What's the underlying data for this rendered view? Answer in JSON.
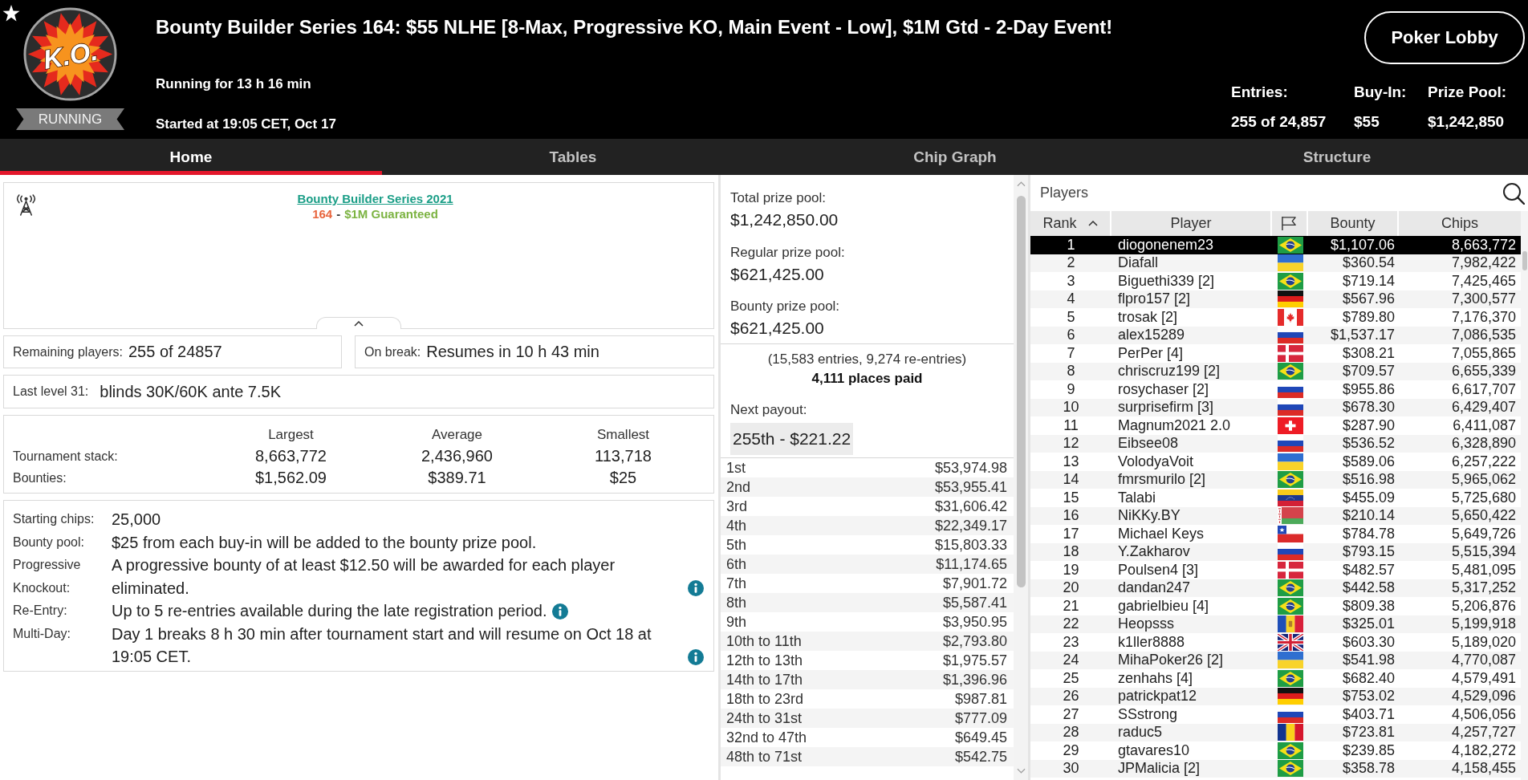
{
  "header": {
    "logo_text": "K.O.",
    "status": "RUNNING",
    "title": "Bounty Builder Series 164: $55 NLHE [8-Max, Progressive KO, Main Event - Low], $1M Gtd - 2-Day Event!",
    "running_for": "Running for 13 h 16 min",
    "started_at": "Started at 19:05 CET, Oct 17",
    "lobby_button": "Poker Lobby",
    "stats": [
      {
        "label": "Entries:",
        "value": "255 of 24,857"
      },
      {
        "label": "Buy-In:",
        "value": "$55"
      },
      {
        "label": "Prize Pool:",
        "value": "$1,242,850"
      }
    ]
  },
  "tabs": [
    {
      "label": "Home",
      "selected": true
    },
    {
      "label": "Tables",
      "selected": false
    },
    {
      "label": "Chip Graph",
      "selected": false
    },
    {
      "label": "Structure",
      "selected": false
    }
  ],
  "home": {
    "banner": {
      "link": "Bounty Builder Series 2021",
      "subtitle": [
        {
          "text": "164",
          "color": "#e8643c"
        },
        {
          "text": "-",
          "color": "#333333"
        },
        {
          "text": "$1M Guaranteed",
          "color": "#7cb342"
        }
      ]
    },
    "status_boxes": [
      {
        "label": "Remaining players:",
        "value": "255 of 24857"
      },
      {
        "label": "On break:",
        "value": "Resumes in 10 h 43 min"
      }
    ],
    "last_level": {
      "label": "Last level 31:",
      "value": "blinds 30K/60K ante 7.5K"
    },
    "stack_table": {
      "columns": [
        "Largest",
        "Average",
        "Smallest"
      ],
      "rows": [
        {
          "label": "Tournament stack:",
          "values": [
            "8,663,772",
            "2,436,960",
            "113,718"
          ]
        },
        {
          "label": "Bounties:",
          "values": [
            "$1,562.09",
            "$389.71",
            "$25"
          ]
        }
      ]
    },
    "details": [
      {
        "label": "Starting chips:",
        "value": "25,000",
        "info": false
      },
      {
        "label": "Bounty pool:",
        "value": "$25 from each buy-in will be added to the bounty prize pool.",
        "info": false
      },
      {
        "label": "Progressive Knockout:",
        "value": "A progressive bounty of at least $12.50 will be awarded for each player eliminated.",
        "info": true
      },
      {
        "label": "Re-Entry:",
        "value": "Up to 5 re-entries available during the late registration period.",
        "info": true
      },
      {
        "label": "Multi-Day:",
        "value": "Day 1 breaks 8 h 30 min after tournament start and will resume on Oct 18 at 19:05 CET.",
        "info": true
      }
    ]
  },
  "prizes": {
    "pools": [
      {
        "label": "Total prize pool:",
        "value": "$1,242,850.00"
      },
      {
        "label": "Regular prize pool:",
        "value": "$621,425.00"
      },
      {
        "label": "Bounty prize pool:",
        "value": "$621,425.00"
      }
    ],
    "entries_note": "(15,583 entries, 9,274 re-entries)",
    "places_paid": "4,111 places paid",
    "next_payout": {
      "label": "Next payout:",
      "value": "255th - $221.22"
    },
    "payouts": [
      {
        "place": "1st",
        "amount": "$53,974.98"
      },
      {
        "place": "2nd",
        "amount": "$53,955.41"
      },
      {
        "place": "3rd",
        "amount": "$31,606.42"
      },
      {
        "place": "4th",
        "amount": "$22,349.17"
      },
      {
        "place": "5th",
        "amount": "$15,803.33"
      },
      {
        "place": "6th",
        "amount": "$11,174.65"
      },
      {
        "place": "7th",
        "amount": "$7,901.72"
      },
      {
        "place": "8th",
        "amount": "$5,587.41"
      },
      {
        "place": "9th",
        "amount": "$3,950.95"
      },
      {
        "place": "10th to 11th",
        "amount": "$2,793.80"
      },
      {
        "place": "12th to 13th",
        "amount": "$1,975.57"
      },
      {
        "place": "14th to 17th",
        "amount": "$1,396.96"
      },
      {
        "place": "18th to 23rd",
        "amount": "$987.81"
      },
      {
        "place": "24th to 31st",
        "amount": "$777.09"
      },
      {
        "place": "32nd to 47th",
        "amount": "$649.45"
      },
      {
        "place": "48th to 71st",
        "amount": "$542.75"
      }
    ]
  },
  "players": {
    "title": "Players",
    "columns": [
      {
        "kind": "text",
        "label": "Rank",
        "sorted": true
      },
      {
        "kind": "text",
        "label": "Player",
        "sorted": false
      },
      {
        "kind": "flag",
        "sorted": false
      },
      {
        "kind": "text",
        "label": "Bounty",
        "sorted": false
      },
      {
        "kind": "text",
        "label": "Chips",
        "sorted": false
      }
    ],
    "rows": [
      {
        "rank": "1",
        "player": "diogonenem23",
        "kind": "brazil",
        "bounty": "$1,107.06",
        "chips": "8,663,772",
        "selected": true
      },
      {
        "rank": "2",
        "player": "Diafall",
        "kind": "ukraine",
        "bounty": "$360.54",
        "chips": "7,982,422",
        "selected": false
      },
      {
        "rank": "3",
        "player": "Biguethi339 [2]",
        "kind": "brazil",
        "bounty": "$719.14",
        "chips": "7,425,465",
        "selected": false
      },
      {
        "rank": "4",
        "player": "flpro157 [2]",
        "kind": "germany",
        "bounty": "$567.96",
        "chips": "7,300,577",
        "selected": false
      },
      {
        "rank": "5",
        "player": "trosak [2]",
        "kind": "canada",
        "bounty": "$789.80",
        "chips": "7,176,370",
        "selected": false
      },
      {
        "rank": "6",
        "player": "alex15289",
        "kind": "russia",
        "bounty": "$1,537.17",
        "chips": "7,086,535",
        "selected": false
      },
      {
        "rank": "7",
        "player": "PerPer [4]",
        "kind": "denmark",
        "bounty": "$308.21",
        "chips": "7,055,865",
        "selected": false
      },
      {
        "rank": "8",
        "player": "chriscruz199 [2]",
        "kind": "brazil",
        "bounty": "$709.57",
        "chips": "6,655,339",
        "selected": false
      },
      {
        "rank": "9",
        "player": "rosychaser [2]",
        "kind": "russia",
        "bounty": "$955.86",
        "chips": "6,617,707",
        "selected": false
      },
      {
        "rank": "10",
        "player": "surprisefirm [3]",
        "kind": "russia",
        "bounty": "$678.30",
        "chips": "6,429,407",
        "selected": false
      },
      {
        "rank": "11",
        "player": "Magnum2021 2.0",
        "kind": "switzerland",
        "bounty": "$287.90",
        "chips": "6,411,087",
        "selected": false
      },
      {
        "rank": "12",
        "player": "Eibsee08",
        "kind": "russia",
        "bounty": "$536.52",
        "chips": "6,328,890",
        "selected": false
      },
      {
        "rank": "13",
        "player": "VolodyaVoit",
        "kind": "ukraine",
        "bounty": "$589.06",
        "chips": "6,257,222",
        "selected": false
      },
      {
        "rank": "14",
        "player": "fmrsmurilo [2]",
        "kind": "brazil",
        "bounty": "$516.98",
        "chips": "5,965,062",
        "selected": false
      },
      {
        "rank": "15",
        "player": "Talabi",
        "kind": "venezuela",
        "bounty": "$455.09",
        "chips": "5,725,680",
        "selected": false
      },
      {
        "rank": "16",
        "player": "NiKKy.BY",
        "kind": "belarus",
        "bounty": "$210.14",
        "chips": "5,650,422",
        "selected": false
      },
      {
        "rank": "17",
        "player": "Michael Keys",
        "kind": "chile",
        "bounty": "$784.78",
        "chips": "5,649,726",
        "selected": false
      },
      {
        "rank": "18",
        "player": "Y.Zakharov",
        "kind": "russia",
        "bounty": "$793.15",
        "chips": "5,515,394",
        "selected": false
      },
      {
        "rank": "19",
        "player": "Poulsen4 [3]",
        "kind": "denmark",
        "bounty": "$482.57",
        "chips": "5,481,095",
        "selected": false
      },
      {
        "rank": "20",
        "player": "dandan247",
        "kind": "brazil",
        "bounty": "$442.58",
        "chips": "5,317,252",
        "selected": false
      },
      {
        "rank": "21",
        "player": "gabrielbieu [4]",
        "kind": "brazil",
        "bounty": "$809.38",
        "chips": "5,206,876",
        "selected": false
      },
      {
        "rank": "22",
        "player": "Heopsss",
        "kind": "moldova",
        "bounty": "$325.01",
        "chips": "5,199,918",
        "selected": false
      },
      {
        "rank": "23",
        "player": "k1ller8888",
        "kind": "uk",
        "bounty": "$603.30",
        "chips": "5,189,020",
        "selected": false
      },
      {
        "rank": "24",
        "player": "MihaPoker26 [2]",
        "kind": "ukraine",
        "bounty": "$541.98",
        "chips": "4,770,087",
        "selected": false
      },
      {
        "rank": "25",
        "player": "zenhahs [4]",
        "kind": "brazil",
        "bounty": "$682.40",
        "chips": "4,579,491",
        "selected": false
      },
      {
        "rank": "26",
        "player": "patrickpat12",
        "kind": "germany",
        "bounty": "$753.02",
        "chips": "4,529,096",
        "selected": false
      },
      {
        "rank": "27",
        "player": "SSstrong",
        "kind": "russia",
        "bounty": "$403.71",
        "chips": "4,506,056",
        "selected": false
      },
      {
        "rank": "28",
        "player": "raduc5",
        "kind": "romania",
        "bounty": "$723.81",
        "chips": "4,257,727",
        "selected": false
      },
      {
        "rank": "29",
        "player": "gtavares10",
        "kind": "brazil",
        "bounty": "$239.85",
        "chips": "4,182,272",
        "selected": false
      },
      {
        "rank": "30",
        "player": "JPMalicia [2]",
        "kind": "brazil",
        "bounty": "$358.78",
        "chips": "4,158,455",
        "selected": false
      }
    ]
  }
}
